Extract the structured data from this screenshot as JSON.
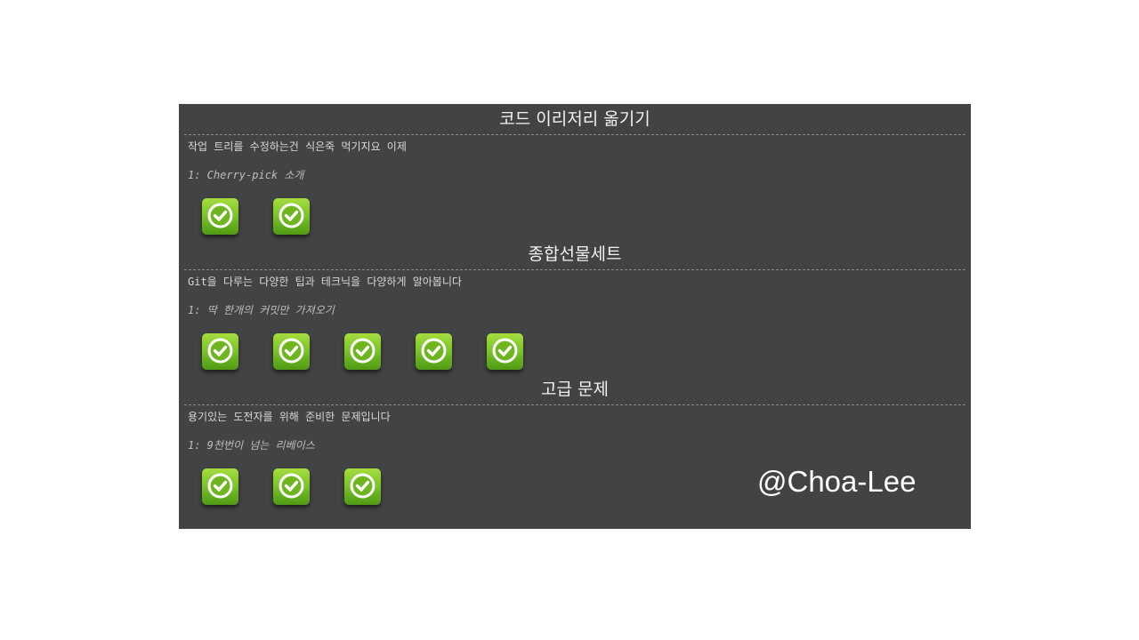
{
  "sections": [
    {
      "title": "코드 이리저리 옮기기",
      "description": "작업 트리를 수정하는건 식은죽 먹기지요 이제",
      "level_label": "1: Cherry-pick 소개",
      "completed_levels": 2
    },
    {
      "title": "종합선물세트",
      "description": "Git을 다루는 다양한 팁과 테크닉을 다양하게 알아봅니다",
      "level_label": "1: 딱 한개의 커밋만 가져오기",
      "completed_levels": 5
    },
    {
      "title": "고급 문제",
      "description": "용기있는 도전자를 위해 준비한 문제입니다",
      "level_label": "1: 9천번이 넘는 리베이스",
      "completed_levels": 3
    }
  ],
  "level_icon": "checkmark-icon",
  "colors": {
    "panel_bg": "#434343",
    "level_green": "#79c229"
  },
  "watermark": "@Choa-Lee"
}
